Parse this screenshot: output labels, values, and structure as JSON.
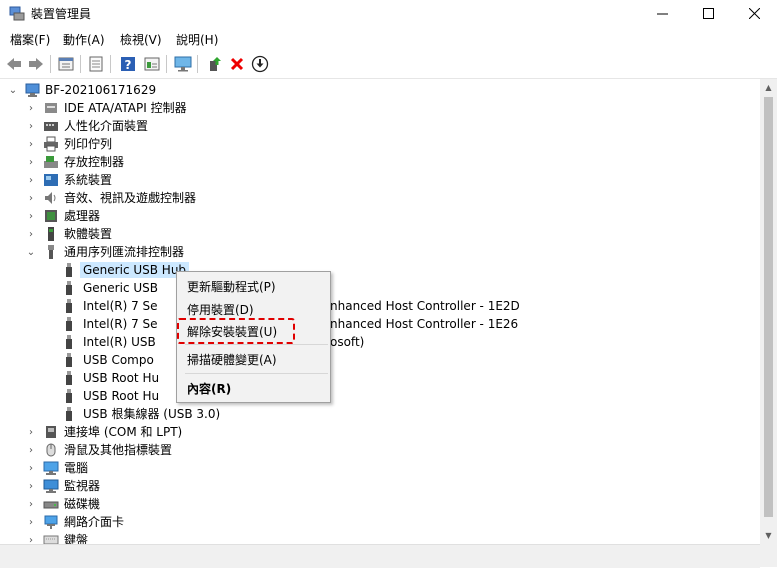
{
  "window": {
    "title": "裝置管理員",
    "minimize": "—",
    "maximize": "☐",
    "close": "✕"
  },
  "menu": [
    "檔案(F)",
    "動作(A)",
    "檢視(V)",
    "說明(H)"
  ],
  "toolbar": {
    "icons": [
      "back-icon",
      "forward-icon",
      "properties-icon",
      "refresh-icon",
      "help-icon",
      "action-icon",
      "monitor-icon",
      "update-driver-icon",
      "uninstall-icon",
      "download-icon"
    ]
  },
  "tree": {
    "root": "BF-202106171629",
    "items": [
      {
        "label": "IDE ATA/ATAPI 控制器",
        "icon": "ide-icon"
      },
      {
        "label": "人性化介面裝置",
        "icon": "hid-icon"
      },
      {
        "label": "列印佇列",
        "icon": "printer-icon"
      },
      {
        "label": "存放控制器",
        "icon": "storage-icon"
      },
      {
        "label": "系統裝置",
        "icon": "system-icon"
      },
      {
        "label": "音效、視訊及遊戲控制器",
        "icon": "audio-icon"
      },
      {
        "label": "處理器",
        "icon": "cpu-icon"
      },
      {
        "label": "軟體裝置",
        "icon": "software-icon"
      },
      {
        "label": "通用序列匯流排控制器",
        "icon": "usb-icon"
      }
    ],
    "usb_children": [
      "Generic USB Hub",
      "Generic USB",
      "Intel(R) 7 Se",
      "Intel(R) 7 Se",
      "Intel(R) USB",
      "USB Compo",
      "USB Root Hu",
      "USB Root Hu",
      "USB 根集線器 (USB 3.0)"
    ],
    "usb_tails": [
      "",
      "",
      "nhanced Host Controller - 1E2D",
      "nhanced Host Controller - 1E26",
      "osoft)",
      "",
      "",
      "",
      ""
    ],
    "after": [
      {
        "label": "連接埠 (COM 和 LPT)",
        "icon": "port-icon"
      },
      {
        "label": "滑鼠及其他指標裝置",
        "icon": "mouse-icon"
      },
      {
        "label": "電腦",
        "icon": "computer-icon"
      },
      {
        "label": "監視器",
        "icon": "monitor-icon"
      },
      {
        "label": "磁碟機",
        "icon": "disk-icon"
      },
      {
        "label": "網路介面卡",
        "icon": "network-icon"
      },
      {
        "label": "鍵盤",
        "icon": "keyboard-icon"
      }
    ]
  },
  "context_menu": {
    "update": "更新驅動程式(P)",
    "disable": "停用裝置(D)",
    "uninstall": "解除安裝裝置(U)",
    "scan": "掃描硬體變更(A)",
    "properties": "內容(R)"
  },
  "colors": {
    "selection": "#cce8ff",
    "highlight_border": "#e00000"
  }
}
